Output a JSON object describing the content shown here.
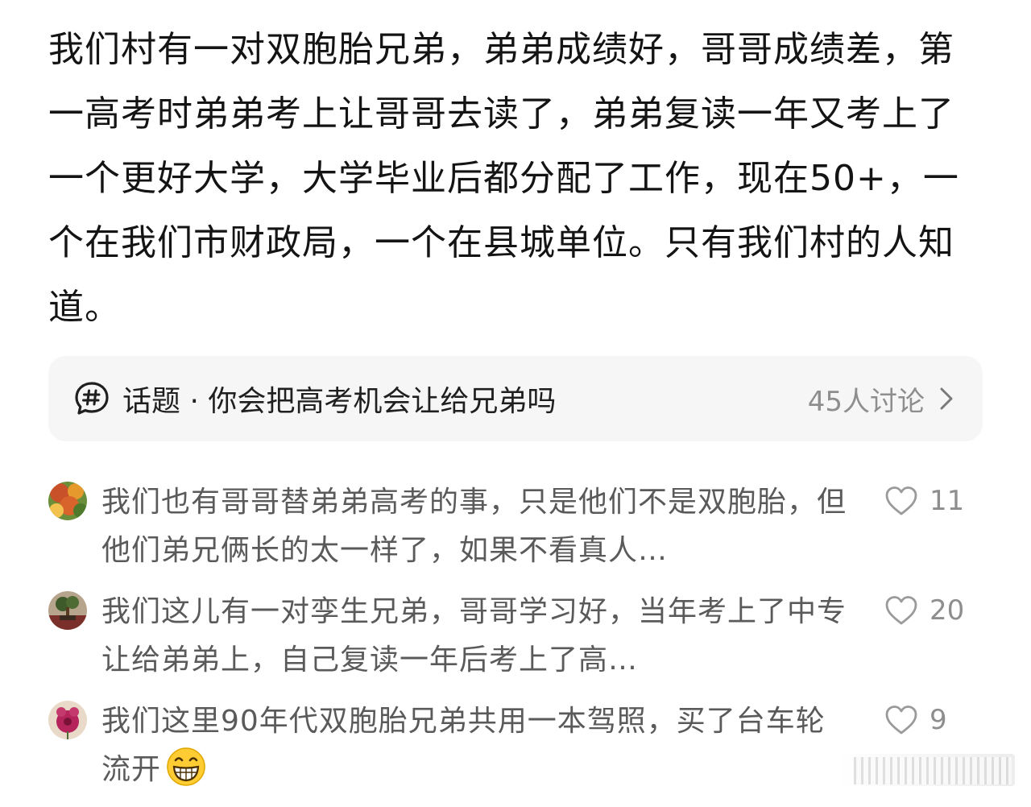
{
  "post": {
    "body": "我们村有一对双胞胎兄弟，弟弟成绩好，哥哥成绩差，第一高考时弟弟考上让哥哥去读了，弟弟复读一年又考上了一个更好大学，大学毕业后都分配了工作，现在50+，一个在我们市财政局，一个在县城单位。只有我们村的人知道。"
  },
  "topic": {
    "icon": "hashtag-chat-icon",
    "label": "话题 · 你会把高考机会让给兄弟吗",
    "discussion_count": "45人讨论",
    "chevron_icon": "chevron-right-icon"
  },
  "comments": [
    {
      "avatar": "autumn-leaves-avatar",
      "text": "我们也有哥哥替弟弟高考的事，只是他们不是双胞胎，但他们弟兄俩长的太一样了，如果不看真人…",
      "likes": "11"
    },
    {
      "avatar": "bonsai-avatar",
      "text": "我们这儿有一对孪生兄弟，哥哥学习好，当年考上了中专让给弟弟上，自己复读一年后考上了高…",
      "likes": "20"
    },
    {
      "avatar": "pink-flower-avatar",
      "text": "我们这里90年代双胞胎兄弟共用一本驾照，买了台车轮流开",
      "emoji": "grinning-face-emoji",
      "likes": "9"
    }
  ],
  "colors": {
    "body_text": "#141414",
    "comment_text": "#5a5a5a",
    "muted": "#8e8e8e",
    "card_bg": "#f6f6f6"
  }
}
